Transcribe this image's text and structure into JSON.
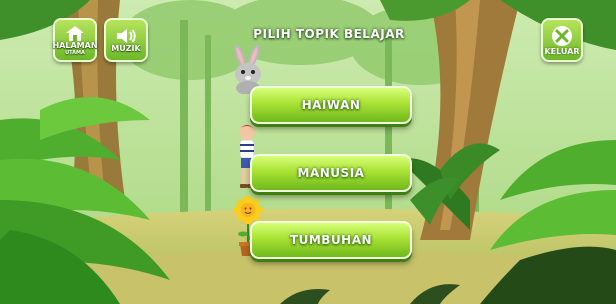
{
  "screen": {
    "title": "PILIH TOPIK BELAJAR"
  },
  "hud": {
    "home_label": "HALAMAN",
    "home_sub_label": "UTAMA",
    "music_label": "MUZIK",
    "exit_label": "KELUAR"
  },
  "topics": [
    {
      "label": "HAIWAN",
      "icon": "rabbit-icon"
    },
    {
      "label": "MANUSIA",
      "icon": "boy-icon"
    },
    {
      "label": "TUMBUHAN",
      "icon": "sunflower-icon"
    }
  ],
  "colors": {
    "button_green": "#a9e234",
    "button_border": "#f2ffe0",
    "text_white": "#ffffff"
  }
}
